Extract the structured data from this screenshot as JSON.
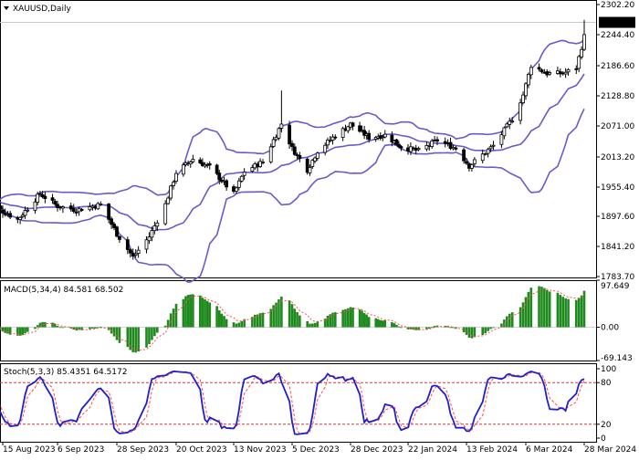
{
  "chart_data": {
    "type": "candlestick",
    "symbol": "XAUUSD,Daily",
    "last_price": "2260.40",
    "colors": {
      "background": "#ffffff",
      "candle": "#000000",
      "bands": "#6a5acd",
      "macd_hist": "#1e8a1e",
      "macd_signal": "#ff4d4d",
      "stoch_main": "#1f1fcc",
      "stoch_signal": "#ff4d4d",
      "level_line": "#d23c3c",
      "price_tag": "#000000"
    },
    "price_panel": {
      "y_ticks": [
        "2302.20",
        "2244.40",
        "2186.60",
        "2128.80",
        "2071.00",
        "2013.20",
        "1955.40",
        "1897.60",
        "1841.20",
        "1783.70"
      ],
      "ylim": [
        1783.7,
        2302.2
      ],
      "bollinger": {
        "period": 20,
        "deviation": 2
      }
    },
    "macd_panel": {
      "label": "MACD(5,34,4) 84.581 68.502",
      "y_ticks": [
        "97.649",
        "0.00",
        "-69.143"
      ],
      "ylim": [
        -69.143,
        97.649
      ],
      "main_value": 84.581,
      "signal_value": 68.502
    },
    "stoch_panel": {
      "label": "Stoch(5,3,3) 85.4351 64.5172",
      "y_ticks": [
        "100",
        "80",
        "20",
        "0"
      ],
      "levels": [
        80,
        20
      ],
      "main_value": 85.4351,
      "signal_value": 64.5172
    },
    "x_labels": [
      "15 Aug 2023",
      "6 Sep 2023",
      "28 Sep 2023",
      "20 Oct 2023",
      "13 Nov 2023",
      "5 Dec 2023",
      "28 Dec 2023",
      "22 Jan 2024",
      "13 Feb 2024",
      "6 Mar 2024",
      "28 Mar 2024"
    ],
    "x_label_dates": [
      "2023-08-15",
      "2023-09-06",
      "2023-09-28",
      "2023-10-20",
      "2023-11-13",
      "2023-12-05",
      "2023-12-28",
      "2024-01-22",
      "2024-02-13",
      "2024-03-06",
      "2024-03-28"
    ],
    "anchors": [
      [
        "2023-08-08",
        1925
      ],
      [
        "2023-08-21",
        1892
      ],
      [
        "2023-08-30",
        1940
      ],
      [
        "2023-09-06",
        1917
      ],
      [
        "2023-09-13",
        1910
      ],
      [
        "2023-09-22",
        1920
      ],
      [
        "2023-09-28",
        1865
      ],
      [
        "2023-10-04",
        1822
      ],
      [
        "2023-10-10",
        1860
      ],
      [
        "2023-10-16",
        1920
      ],
      [
        "2023-10-20",
        1980
      ],
      [
        "2023-10-27",
        2005
      ],
      [
        "2023-11-03",
        1990
      ],
      [
        "2023-11-13",
        1940
      ],
      [
        "2023-11-17",
        1982
      ],
      [
        "2023-11-24",
        2000
      ],
      [
        "2023-12-01",
        2071
      ],
      [
        "2023-12-05",
        2025
      ],
      [
        "2023-12-11",
        1985
      ],
      [
        "2023-12-15",
        2020
      ],
      [
        "2023-12-21",
        2045
      ],
      [
        "2023-12-28",
        2070
      ],
      [
        "2024-01-05",
        2045
      ],
      [
        "2024-01-12",
        2050
      ],
      [
        "2024-01-19",
        2028
      ],
      [
        "2024-01-26",
        2020
      ],
      [
        "2024-02-02",
        2040
      ],
      [
        "2024-02-09",
        2025
      ],
      [
        "2024-02-14",
        1992
      ],
      [
        "2024-02-23",
        2030
      ],
      [
        "2024-03-01",
        2080
      ],
      [
        "2024-03-05",
        2125
      ],
      [
        "2024-03-08",
        2180
      ],
      [
        "2024-03-14",
        2165
      ],
      [
        "2024-03-20",
        2165
      ],
      [
        "2024-03-25",
        2175
      ],
      [
        "2024-03-28",
        2234
      ]
    ],
    "last_candle_high": 2265,
    "bb_first_date": "2023-08-08",
    "bb_warmup_price": 1925
  }
}
